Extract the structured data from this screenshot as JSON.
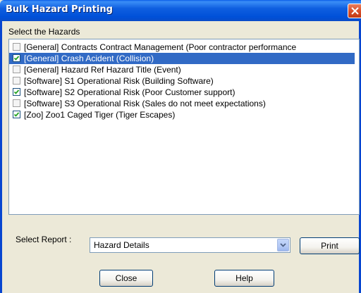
{
  "window": {
    "title": "Bulk Hazard Printing",
    "accent_color": "#0054e3",
    "close_icon": "close-x-icon"
  },
  "hazards": {
    "label": "Select the Hazards",
    "items": [
      {
        "text": "[General] Contracts Contract Management (Poor contractor performance",
        "checked": false,
        "selected": false
      },
      {
        "text": "[General] Crash Acident (Collision)",
        "checked": true,
        "selected": true
      },
      {
        "text": "[General] Hazard Ref Hazard Title (Event)",
        "checked": false,
        "selected": false
      },
      {
        "text": "[Software] S1 Operational Risk (Building Software)",
        "checked": false,
        "selected": false
      },
      {
        "text": "[Software] S2 Operational Risk (Poor Customer support)",
        "checked": true,
        "selected": false
      },
      {
        "text": "[Software] S3 Operational Risk (Sales do not meet expectations)",
        "checked": false,
        "selected": false
      },
      {
        "text": "[Zoo] Zoo1 Caged Tiger (Tiger Escapes)",
        "checked": true,
        "selected": false
      }
    ],
    "selection_color": "#316ac5"
  },
  "report": {
    "label": "Select Report :",
    "selected_value": "Hazard Details"
  },
  "buttons": {
    "print": "Print",
    "close": "Close",
    "help": "Help"
  }
}
